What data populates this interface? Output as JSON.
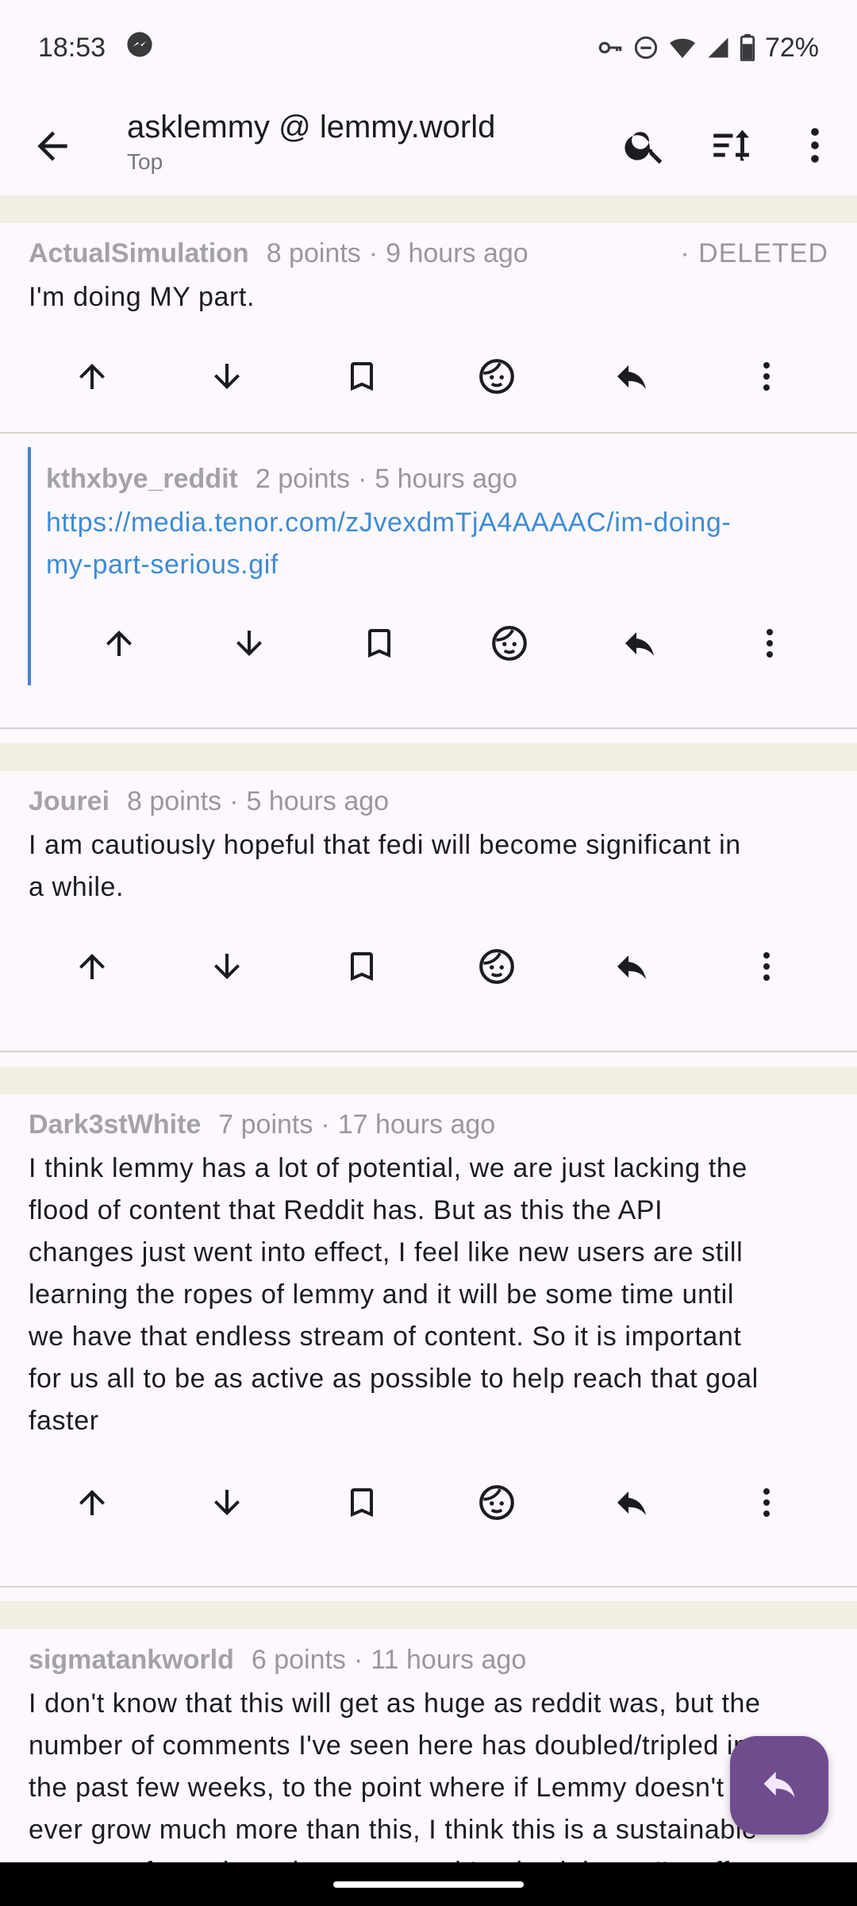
{
  "status_bar": {
    "time": "18:53",
    "battery": "72%",
    "icons": [
      "messenger-icon",
      "vpn-key-icon",
      "do-not-disturb-icon",
      "wifi-icon",
      "signal-icon",
      "battery-icon"
    ]
  },
  "app_bar": {
    "title": "asklemmy @ lemmy.world",
    "subtitle": "Top",
    "icons": [
      "back-arrow-icon",
      "search-icon",
      "sort-icon",
      "more-vert-icon"
    ]
  },
  "comments": [
    {
      "author": "ActualSimulation",
      "points": "8 points",
      "time": "9 hours ago",
      "flag": "· DELETED",
      "lines": [
        "I'm doing MY part."
      ]
    },
    {
      "author": "kthxbye_reddit",
      "points": "2 points",
      "time": "5 hours ago",
      "lines": [
        "https://media.tenor.com/zJvexdmTjA4AAAAC/im-doing-",
        "my-part-serious.gif"
      ],
      "reply_accent": "#4a7fd4"
    },
    {
      "author": "Jourei",
      "points": "8 points",
      "time": "5 hours ago",
      "lines": [
        "I am cautiously hopeful that fedi will become significant in",
        "a while."
      ]
    },
    {
      "author": "Dark3stWhite",
      "points": "7 points",
      "time": "17 hours ago",
      "lines": [
        "I think lemmy has a lot of potential, we are just lacking the",
        "flood of content that Reddit has. But as this the API",
        "changes just went into effect, I feel like new users are still",
        "learning the ropes of lemmy and it will be some time until",
        "we have that endless stream of content. So it is important",
        "for us all to be as active as possible to help reach that goal",
        "faster"
      ]
    },
    {
      "author": "sigmatankworld",
      "points": "6 points",
      "time": "11 hours ago",
      "lines": [
        "I don't know that this will get as huge as reddit was, but the",
        "number of comments I've seen here has doubled/tripled in",
        "the past few weeks, to the point where if Lemmy doesn't",
        "ever grow much more than this, I think this is a sustainable",
        "amount of people and content, and I enjoy it here. I'm off"
      ]
    }
  ],
  "action_icons": [
    "upvote-icon",
    "downvote-icon",
    "bookmark-icon",
    "face-icon",
    "reply-icon",
    "more-vert-icon"
  ],
  "fab": {
    "icon": "reply-icon",
    "color": "#6e4c8e"
  }
}
